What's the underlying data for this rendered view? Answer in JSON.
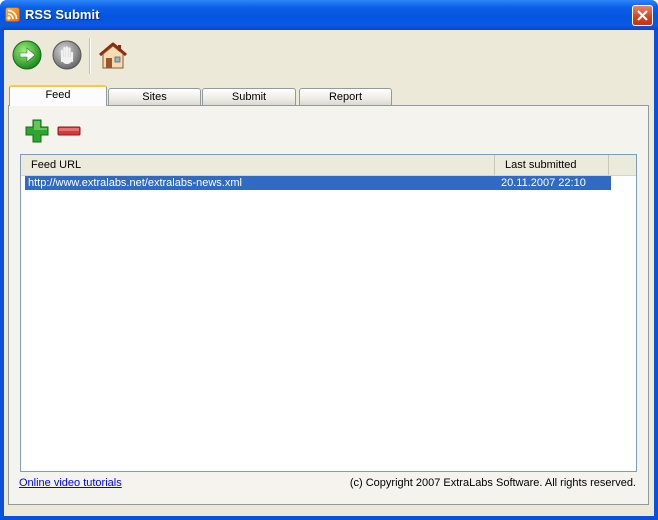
{
  "window": {
    "title": "RSS Submit"
  },
  "toolbar": {
    "start_icon": "green-arrow-icon",
    "stop_icon": "stop-hand-icon",
    "home_icon": "home-icon"
  },
  "tabs": [
    {
      "label": "Feed",
      "active": true
    },
    {
      "label": "Sites"
    },
    {
      "label": "Submit"
    },
    {
      "label": "Report"
    }
  ],
  "feed_panel": {
    "add_icon": "add-plus-icon",
    "remove_icon": "remove-minus-icon",
    "columns": [
      "Feed URL",
      "Last submitted"
    ],
    "rows": [
      {
        "url": "http://www.extralabs.net/extralabs-news.xml",
        "last_submitted": "20.11.2007 22:10",
        "selected": true
      }
    ]
  },
  "footer": {
    "link": "Online video tutorials",
    "copyright": "(c) Copyright 2007 ExtraLabs Software. All rights reserved."
  },
  "colors": {
    "selection": "#316ac5",
    "titlebar": "#0555e0",
    "client": "#ece9d8"
  }
}
